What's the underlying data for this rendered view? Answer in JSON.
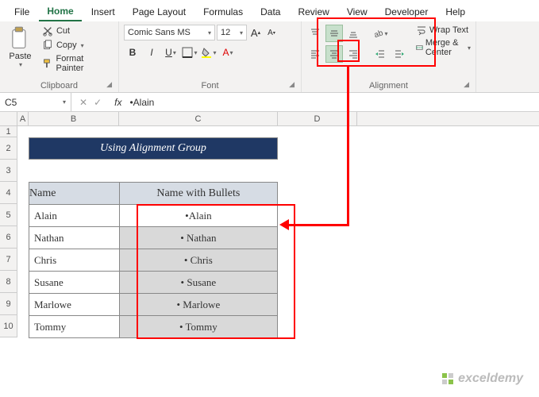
{
  "tabs": [
    "File",
    "Home",
    "Insert",
    "Page Layout",
    "Formulas",
    "Data",
    "Review",
    "View",
    "Developer",
    "Help"
  ],
  "active_tab": "Home",
  "clipboard": {
    "paste": "Paste",
    "cut": "Cut",
    "copy": "Copy",
    "painter": "Format Painter",
    "label": "Clipboard"
  },
  "font": {
    "name": "Comic Sans MS",
    "size": "12",
    "label": "Font"
  },
  "alignment": {
    "label": "Alignment",
    "wrap": "Wrap Text",
    "merge": "Merge & Center"
  },
  "namebox": "C5",
  "formula": "•Alain",
  "columns": [
    "A",
    "B",
    "C",
    "D"
  ],
  "rows": [
    "1",
    "2",
    "3",
    "4",
    "5",
    "6",
    "7",
    "8",
    "9",
    "10"
  ],
  "title": "Using Alignment Group",
  "headers": {
    "name": "Name",
    "bullet": "Name with Bullets"
  },
  "data": [
    {
      "name": "Alain",
      "bullet": "•Alain"
    },
    {
      "name": "Nathan",
      "bullet": "• Nathan"
    },
    {
      "name": "Chris",
      "bullet": "• Chris"
    },
    {
      "name": "Susane",
      "bullet": "• Susane"
    },
    {
      "name": "Marlowe",
      "bullet": "• Marlowe"
    },
    {
      "name": "Tommy",
      "bullet": "• Tommy"
    }
  ],
  "watermark": "exceldemy"
}
